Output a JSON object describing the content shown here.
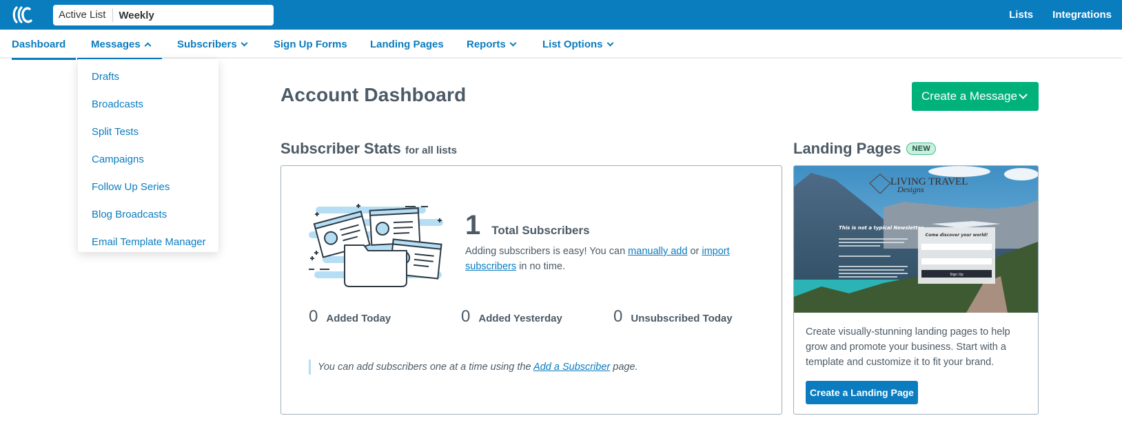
{
  "header": {
    "logo_icon": "aweber-logo-icon",
    "active_list_label": "Active List",
    "active_list_value": "Weekly",
    "links": [
      "Lists",
      "Integrations"
    ]
  },
  "nav": {
    "items": [
      {
        "label": "Dashboard",
        "has_chevron": false,
        "active": true
      },
      {
        "label": "Messages",
        "has_chevron": true,
        "chevron": "up",
        "active": true
      },
      {
        "label": "Subscribers",
        "has_chevron": true,
        "chevron": "down"
      },
      {
        "label": "Sign Up Forms",
        "has_chevron": false
      },
      {
        "label": "Landing Pages",
        "has_chevron": false
      },
      {
        "label": "Reports",
        "has_chevron": true,
        "chevron": "down"
      },
      {
        "label": "List Options",
        "has_chevron": true,
        "chevron": "down"
      }
    ],
    "messages_dropdown": [
      "Drafts",
      "Broadcasts",
      "Split Tests",
      "Campaigns",
      "Follow Up Series",
      "Blog Broadcasts",
      "Email Template Manager"
    ]
  },
  "main": {
    "title": "Account Dashboard",
    "create_message_label": "Create a Message",
    "stats": {
      "title": "Subscriber Stats",
      "subtitle": "for all lists",
      "total_value": "1",
      "total_label": "Total Subscribers",
      "adding_text_1": "Adding subscribers is easy! You can ",
      "manual_add_link": "manually add",
      "adding_text_2": " or ",
      "import_link": "import subscribers",
      "adding_text_3": " in no time.",
      "added_today_value": "0",
      "added_today_label": "Added Today",
      "added_yesterday_value": "0",
      "added_yesterday_label": "Added Yesterday",
      "unsubscribed_today_value": "0",
      "unsubscribed_today_label": "Unsubscribed Today",
      "note_text_1": "You can add subscribers one at a time using the ",
      "note_link": "Add a Subscriber",
      "note_text_2": " page."
    },
    "landing_pages": {
      "title": "Landing Pages",
      "badge": "NEW",
      "preview": {
        "brand_line1": "LIVING TRAVEL",
        "brand_line2": "Designs",
        "headline": "This is not a typical Newsletter.",
        "form_title": "Come discover your world!",
        "form_button": "Sign Up"
      },
      "description": "Create visually-stunning landing pages to help grow and promote your business. Start with a template and customize it to fit your brand.",
      "button_label": "Create a Landing Page"
    }
  },
  "colors": {
    "header_blue": "#0a7dbf",
    "link_blue": "#0a7cbf",
    "create_green": "#00b27a",
    "text_slate": "#4b5a66",
    "badge_green": "#c9f0de"
  }
}
